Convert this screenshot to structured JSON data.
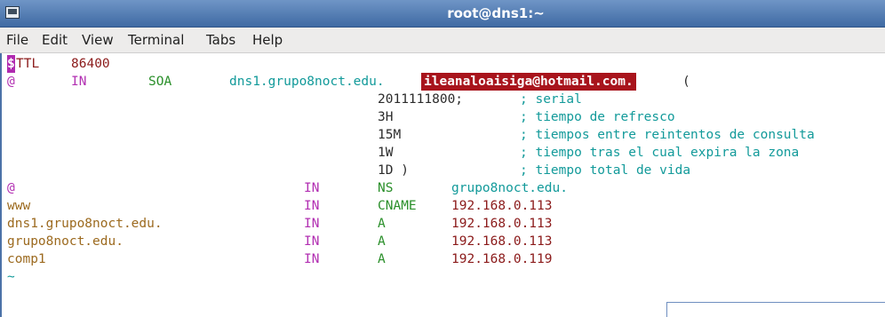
{
  "window": {
    "title": "root@dns1:~"
  },
  "menu": {
    "file": "File",
    "edit": "Edit",
    "view": "View",
    "terminal": "Terminal",
    "tabs": "Tabs",
    "help": "Help"
  },
  "terminal_lines": {
    "l1": {
      "cursor": "$",
      "key": "TTL",
      "value": "86400"
    },
    "l2": {
      "name": "@",
      "class": "IN",
      "type": "SOA",
      "ns": "dns1.grupo8noct.edu.",
      "email": "ileanaloaisiga@hotmail.com.",
      "paren": "("
    },
    "l3": {
      "val": "2011111800;",
      "comment": "; serial"
    },
    "l4": {
      "val": "3H",
      "comment": "; tiempo de refresco"
    },
    "l5": {
      "val": "15M",
      "comment": "; tiempos entre reintentos de consulta"
    },
    "l6": {
      "val": "1W",
      "comment": "; tiempo tras el cual expira la zona"
    },
    "l7": {
      "val": "1D )",
      "comment": "; tiempo total de vida"
    },
    "r1": {
      "name": "@",
      "class": "IN",
      "type": "NS",
      "data": "grupo8noct.edu."
    },
    "r2": {
      "name": "www",
      "class": "IN",
      "type": "CNAME",
      "data": "192.168.0.113"
    },
    "r3": {
      "name": "dns1.grupo8noct.edu.",
      "class": "IN",
      "type": "A",
      "data": "192.168.0.113"
    },
    "r4": {
      "name": "grupo8noct.edu.",
      "class": "IN",
      "type": "A",
      "data": "192.168.0.113"
    },
    "r5": {
      "name": "comp1",
      "class": "IN",
      "type": "A",
      "data": "192.168.0.119"
    },
    "last": "~"
  },
  "colors": {
    "titlebar": "#4f7ab3",
    "email_highlight": "#a8141c",
    "keyword": "#8b1a1a",
    "host": "#129a9a",
    "type": "#2a8f2a",
    "class": "#b22fb2",
    "name": "#9c6a1f"
  }
}
